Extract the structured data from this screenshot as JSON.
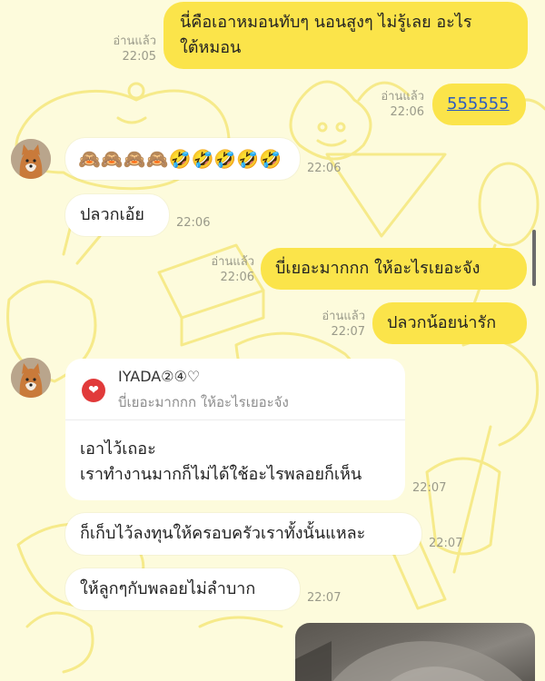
{
  "colors": {
    "background": "#fdfbdc",
    "outgoing_bubble": "#fbe44a",
    "incoming_bubble": "#ffffff",
    "link": "#2c5bbf",
    "reply_icon": "#e13a3a"
  },
  "messages": {
    "m1": {
      "line1": "นี่คือเอาหมอนทับๆ นอนสูงๆ ไม่รู้เลย อะไร",
      "line2": "ใต้หมอน",
      "read": "อ่านแล้ว",
      "time": "22:05"
    },
    "m2": {
      "text": "555555",
      "read": "อ่านแล้ว",
      "time": "22:06"
    },
    "m3": {
      "text": "🙈🙈🙈🙈🤣🤣🤣🤣🤣",
      "time": "22:06"
    },
    "m4": {
      "text": "ปลวกเอ้ย",
      "time": "22:06"
    },
    "m5": {
      "text": "บี่เยอะมากกก ให้อะไรเยอะจัง",
      "read": "อ่านแล้ว",
      "time": "22:06"
    },
    "m6": {
      "text": "ปลวกน้อยน่ารัก",
      "read": "อ่านแล้ว",
      "time": "22:07"
    },
    "m7": {
      "reply_name": "IYADA②④♡",
      "reply_quote": "บี่เยอะมากกก ให้อะไรเยอะจัง",
      "line1": "เอาไว้เถอะ",
      "line2": "เราทำงานมากก็ไม่ได้ใช้อะไรพลอยก็เห็น",
      "time": "22:07"
    },
    "m8": {
      "text": "ก็เก็บไว้ลงทุนให้ครอบครัวเราทั้งนั้นแหละ",
      "time": "22:07"
    },
    "m9": {
      "text": "ให้ลูกๆกับพลอยไม่ลำบาก",
      "time": "22:07"
    }
  }
}
